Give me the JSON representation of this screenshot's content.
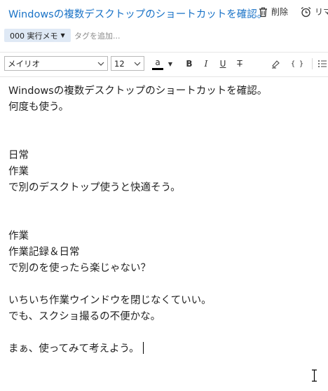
{
  "note": {
    "title": "Windowsの複数デスクトップのショートカットを確認。",
    "actions": {
      "delete_label": "削除",
      "delete_icon": "trash-icon",
      "reminder_label": "リマ",
      "reminder_icon": "alarm-clock-icon"
    },
    "notebook": {
      "label": "000 実行メモ"
    },
    "tag_placeholder": "タグを追加..."
  },
  "toolbar": {
    "font_family": "メイリオ",
    "font_size": "12",
    "text_color_glyph": "a",
    "text_color": "#000000",
    "bold_glyph": "B",
    "italic_glyph": "I",
    "underline_glyph": "U",
    "strikethrough_glyph": "T",
    "code_glyph": "{ }"
  },
  "body": {
    "lines": [
      "Windowsの複数デスクトップのショートカットを確認。",
      "何度も使う。",
      "",
      "",
      "日常",
      "作業",
      "で別のデスクトップ使うと快適そう。",
      "",
      "",
      "作業",
      "作業記録＆日常",
      "で別のを使ったら楽じゃない？",
      "",
      "いちいち作業ウインドウを閉じなくていい。",
      "でも、スクショ撮るの不便かな。",
      "",
      "まぁ、使ってみて考えよう。"
    ]
  }
}
